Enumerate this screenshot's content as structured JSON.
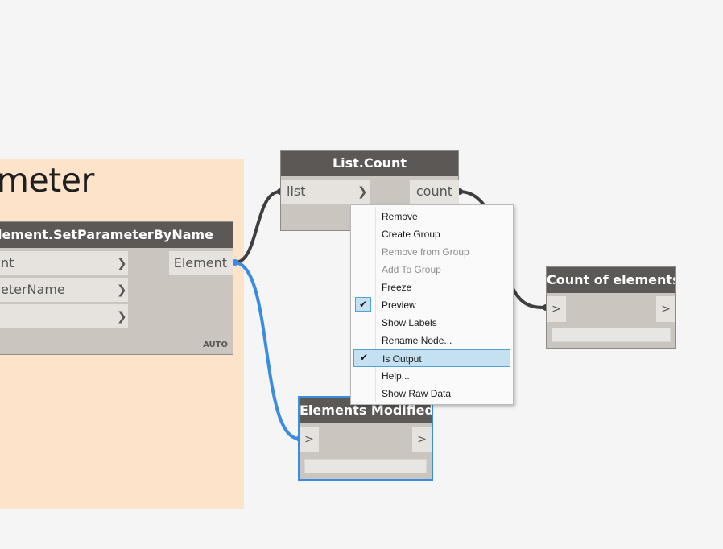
{
  "group": {
    "title": "meter"
  },
  "set_param_node": {
    "title": "lement.SetParameterByName",
    "inputs": [
      "nt",
      "eterName",
      ""
    ],
    "output": "Element",
    "badge": "AUTO"
  },
  "list_count_node": {
    "title": "List.Count",
    "input": "list",
    "output": "count"
  },
  "count_of_elements_node": {
    "title": "Count of elements",
    "input": ">",
    "output": ">"
  },
  "elements_modified_node": {
    "title": "Elements Modified",
    "input": ">",
    "output": ">"
  },
  "context_menu": {
    "items": [
      {
        "label": "Remove",
        "disabled": false,
        "checked": false
      },
      {
        "label": "Create Group",
        "disabled": false,
        "checked": false
      },
      {
        "label": "Remove from Group",
        "disabled": true,
        "checked": false
      },
      {
        "label": "Add To Group",
        "disabled": true,
        "checked": false
      },
      {
        "label": "Freeze",
        "disabled": false,
        "checked": false
      },
      {
        "label": "Preview",
        "disabled": false,
        "checked": true
      },
      {
        "label": "Show Labels",
        "disabled": false,
        "checked": false
      },
      {
        "label": "Rename Node...",
        "disabled": false,
        "checked": false
      },
      {
        "label": "Is Output",
        "disabled": false,
        "checked": true,
        "highlighted": true
      },
      {
        "label": "Help...",
        "disabled": false,
        "checked": false
      },
      {
        "label": "Show Raw Data",
        "disabled": false,
        "checked": false
      }
    ]
  },
  "colors": {
    "wire": "#3e3e3e",
    "selected_wire": "#3b8ce0",
    "group": "#fce3c9",
    "node_header": "#5b5855"
  }
}
